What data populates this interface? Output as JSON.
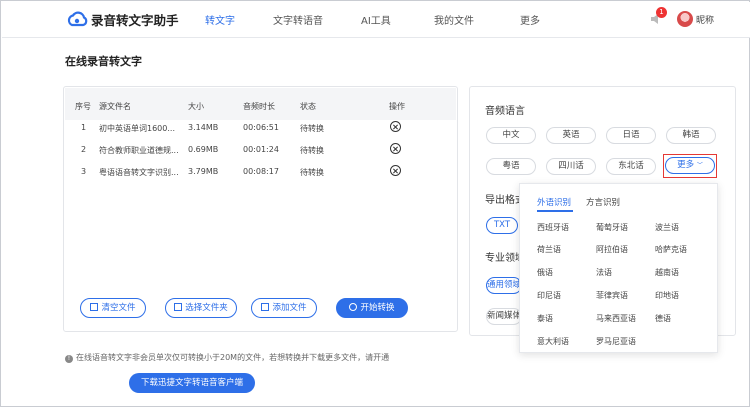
{
  "header": {
    "app_title": "录音转文字助手",
    "nav": [
      "转文字",
      "文字转语音",
      "AI工具",
      "我的文件",
      "更多"
    ],
    "badge_count": "1",
    "nickname": "昵称"
  },
  "page_title": "在线录音转文字",
  "table": {
    "headers": [
      "序号",
      "源文件名",
      "大小",
      "音频时长",
      "状态",
      "操作"
    ],
    "rows": [
      {
        "index": "1",
        "name": "初中英语单词1600...",
        "size": "3.14MB",
        "duration": "00:06:51",
        "status": "待转换"
      },
      {
        "index": "2",
        "name": "符合教师职业道德规...",
        "size": "0.69MB",
        "duration": "00:01:24",
        "status": "待转换"
      },
      {
        "index": "3",
        "name": "粤语语音转文字识别...",
        "size": "3.79MB",
        "duration": "00:08:17",
        "status": "待转换"
      }
    ]
  },
  "buttons": {
    "clear": "清空文件",
    "choose_folder": "选择文件夹",
    "add_file": "添加文件",
    "start": "开始转换"
  },
  "notice": "在线语音转文字非会员单次仅可转换小于20M的文件，若想转换并下载更多文件，请开通",
  "download_button": "下载迅捷文字转语音客户端",
  "right_panel": {
    "audio_language_title": "音频语言",
    "languages_row1": [
      "中文",
      "英语",
      "日语",
      "韩语"
    ],
    "languages_row2": [
      "粤语",
      "四川话",
      "东北话"
    ],
    "more_label": "更多",
    "export_title": "导出格式",
    "export_chip": "TXT",
    "domain_title": "专业领域",
    "domain_chip": "通用领域",
    "news_chip": "新闻媒体"
  },
  "dropdown": {
    "tabs": [
      "外语识别",
      "方言识别"
    ],
    "items": [
      [
        "西班牙语",
        "葡萄牙语",
        "波兰语"
      ],
      [
        "荷兰语",
        "阿拉伯语",
        "哈萨克语"
      ],
      [
        "俄语",
        "法语",
        "越南语"
      ],
      [
        "印尼语",
        "菲律宾语",
        "印地语"
      ],
      [
        "泰语",
        "马来西亚语",
        "德语"
      ],
      [
        "意大利语",
        "罗马尼亚语",
        ""
      ]
    ]
  },
  "colors": {
    "accent": "#2e6fe8",
    "highlight_box": "#e53935",
    "badge": "#ee3333"
  }
}
